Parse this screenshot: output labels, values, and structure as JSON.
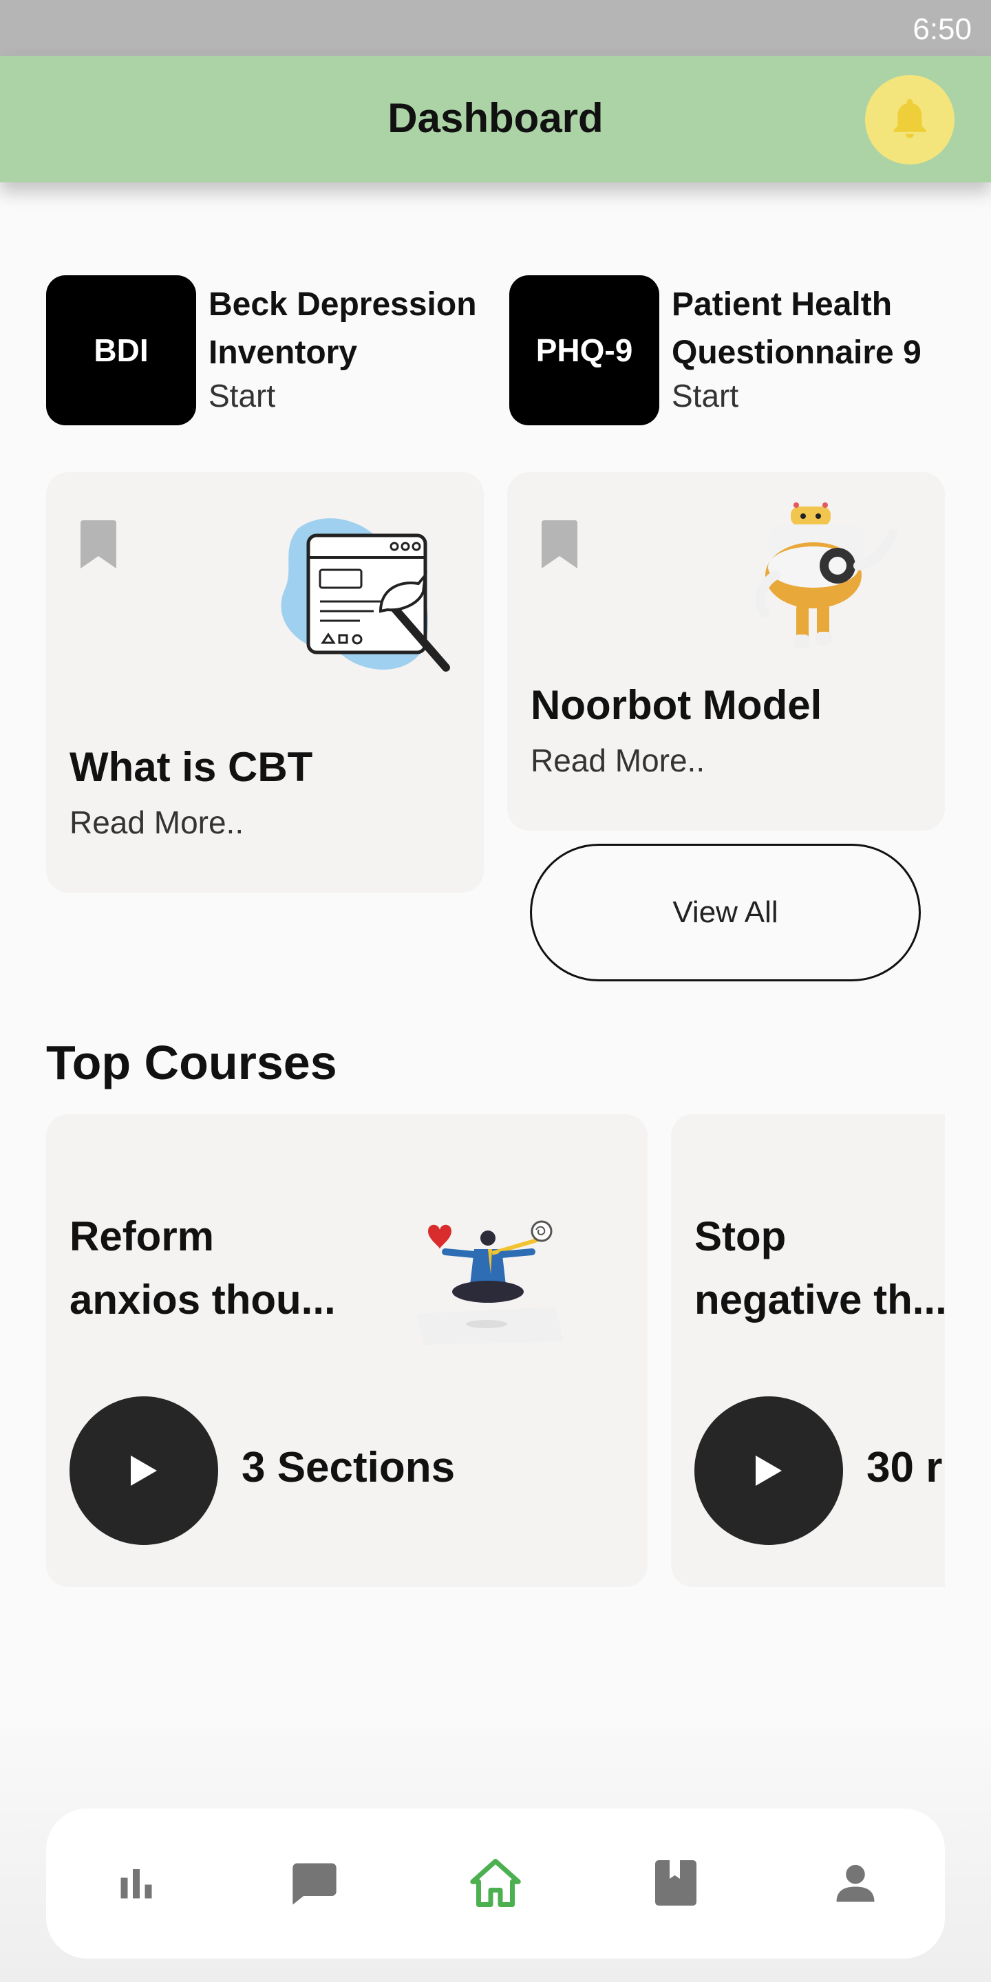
{
  "status_bar": {
    "time": "6:50"
  },
  "app_bar": {
    "title": "Dashboard",
    "bell_color": "#f4e47c",
    "background": "#abd3a6"
  },
  "tests": [
    {
      "code": "BDI",
      "name_line1": "Beck Depression",
      "name_line2": "Inventory",
      "action": "Start"
    },
    {
      "code": "PHQ-9",
      "name_line1": "Patient Health",
      "name_line2": "Questionnaire 9",
      "action": "Start"
    }
  ],
  "articles": [
    {
      "title": "What is CBT",
      "link": "Read More..",
      "image": "cbt-browser-illustration"
    },
    {
      "title": "Noorbot Model",
      "link": "Read More..",
      "image": "robot-illustration"
    }
  ],
  "view_all_label": "View All",
  "top_courses": {
    "heading": "Top Courses",
    "items": [
      {
        "title_line1": "Reform",
        "title_line2": "anxios thou...",
        "count": "3 Sections",
        "image": "meditation-illustration"
      },
      {
        "title_line1": "Stop",
        "title_line2": "negative th...",
        "count": "30 r"
      }
    ]
  },
  "bottom_nav": {
    "active": "home",
    "items": [
      "stats-icon",
      "chat-icon",
      "home-icon",
      "book-icon",
      "profile-icon"
    ],
    "active_color": "#4caf50",
    "inactive_color": "#757575"
  }
}
